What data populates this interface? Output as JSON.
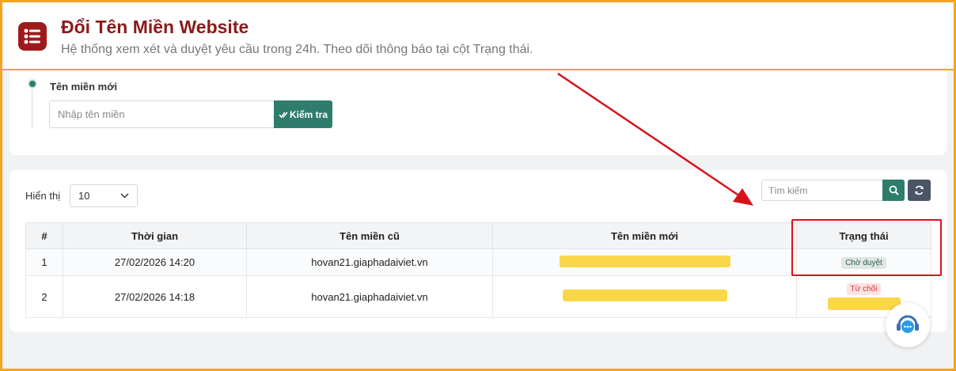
{
  "header": {
    "title": "Đổi Tên Miền Website",
    "subtitle": "Hệ thống xem xét và duyệt yêu cầu trong 24h. Theo dõi thông báo tại cột Trạng thái."
  },
  "form": {
    "label": "Tên miền mới",
    "input_placeholder": "Nhập tên miền",
    "check_label": "Kiểm tra"
  },
  "list": {
    "show_label": "Hiển thị",
    "page_size": "10",
    "search_placeholder": "Tìm kiếm"
  },
  "table": {
    "columns": [
      "#",
      "Thời gian",
      "Tên miền cũ",
      "Tên miền mới",
      "Trạng thái"
    ],
    "rows": [
      {
        "index": "1",
        "time": "27/02/2026 14:20",
        "old_domain": "hovan21.giaphadaiviet.vn",
        "status": "Chờ duyệt"
      },
      {
        "index": "2",
        "time": "27/02/2026 14:18",
        "old_domain": "hovan21.giaphadaiviet.vn",
        "status": "Từ chối"
      }
    ]
  },
  "colors": {
    "brand": "#8b1a1a",
    "accent": "#2e7d6c",
    "frame": "#f4a420",
    "annotation": "#d8121a",
    "redaction": "#f9d43a"
  }
}
